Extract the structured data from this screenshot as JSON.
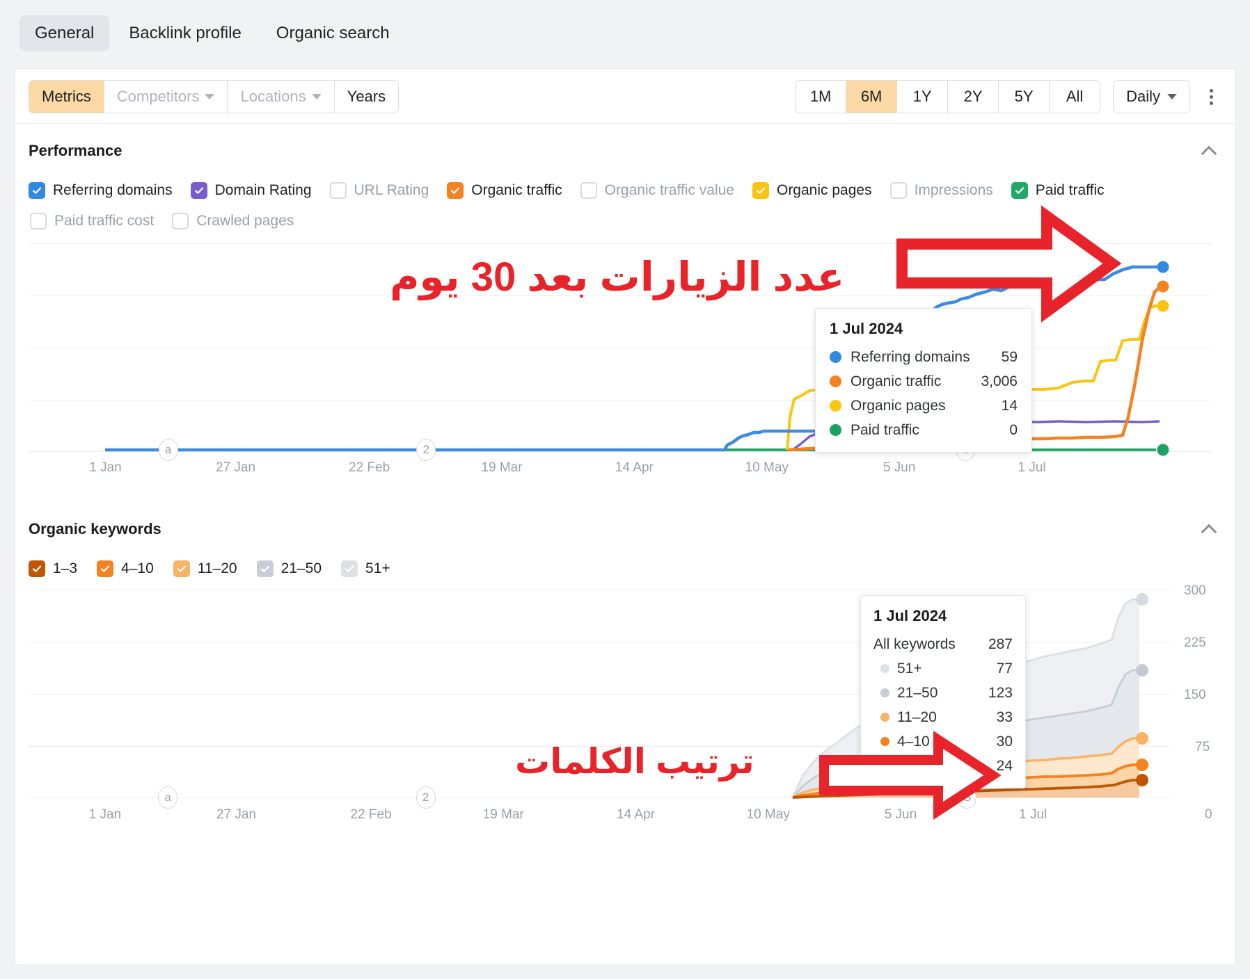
{
  "tabs": [
    {
      "label": "General",
      "active": true
    },
    {
      "label": "Backlink profile",
      "active": false
    },
    {
      "label": "Organic search",
      "active": false
    }
  ],
  "toolbar": {
    "metrics_label": "Metrics",
    "competitors_label": "Competitors",
    "locations_label": "Locations",
    "years_label": "Years",
    "ranges": [
      "1M",
      "6M",
      "1Y",
      "2Y",
      "5Y",
      "All"
    ],
    "range_selected": "6M",
    "granularity_label": "Daily",
    "more_label": "More options"
  },
  "performance": {
    "title": "Performance",
    "metrics": [
      {
        "label": "Referring domains",
        "checked": true,
        "color": "#2f8ae0"
      },
      {
        "label": "Domain Rating",
        "checked": true,
        "color": "#7a5bd0"
      },
      {
        "label": "URL Rating",
        "checked": false,
        "color": "#d7dadd"
      },
      {
        "label": "Organic traffic",
        "checked": true,
        "color": "#f58220"
      },
      {
        "label": "Organic traffic value",
        "checked": false,
        "color": "#d7dadd"
      },
      {
        "label": "Organic pages",
        "checked": true,
        "color": "#fbc411"
      },
      {
        "label": "Impressions",
        "checked": false,
        "color": "#d7dadd"
      },
      {
        "label": "Paid traffic",
        "checked": true,
        "color": "#22a866"
      },
      {
        "label": "Paid traffic cost",
        "checked": false,
        "color": "#d7dadd"
      },
      {
        "label": "Crawled pages",
        "checked": false,
        "color": "#d7dadd"
      }
    ],
    "x_ticks": [
      "1 Jan",
      "27 Jan",
      "22 Feb",
      "19 Mar",
      "14 Apr",
      "10 May",
      "5 Jun",
      "1 Jul"
    ],
    "events": [
      {
        "label": "a",
        "x": 0.105
      },
      {
        "label": "2",
        "x": 0.345
      },
      {
        "label": "G",
        "x": 0.862
      }
    ],
    "tooltip": {
      "date": "1 Jul 2024",
      "rows": [
        {
          "name": "Referring domains",
          "value": "59",
          "color": "#2f8ae0"
        },
        {
          "name": "Organic traffic",
          "value": "3,006",
          "color": "#f58220"
        },
        {
          "name": "Organic pages",
          "value": "14",
          "color": "#fbc411"
        },
        {
          "name": "Paid traffic",
          "value": "0",
          "color": "#1aa260"
        }
      ]
    },
    "annotation": "عدد الزيارات بعد 30 يوم"
  },
  "organic_keywords": {
    "title": "Organic keywords",
    "buckets": [
      {
        "label": "1–3",
        "checked": true,
        "color": "#c05600"
      },
      {
        "label": "4–10",
        "checked": true,
        "color": "#f58220"
      },
      {
        "label": "11–20",
        "checked": true,
        "color": "#fbb264"
      },
      {
        "label": "21–50",
        "checked": true,
        "color": "#c9ced6"
      },
      {
        "label": "51+",
        "checked": true,
        "color": "#dde1e6"
      }
    ],
    "x_ticks": [
      "1 Jan",
      "27 Jan",
      "22 Feb",
      "19 Mar",
      "14 Apr",
      "10 May",
      "5 Jun",
      "1 Jul"
    ],
    "y_ticks": [
      "300",
      "225",
      "150",
      "75",
      "0"
    ],
    "events": [
      {
        "label": "a",
        "x": 0.105
      },
      {
        "label": "2",
        "x": 0.345
      },
      {
        "label": "G",
        "x": 0.862
      }
    ],
    "tooltip": {
      "date": "1 Jul 2024",
      "total_label": "All keywords",
      "total_value": "287",
      "rows": [
        {
          "name": "51+",
          "value": "77",
          "color": "#dde1e6"
        },
        {
          "name": "21–50",
          "value": "123",
          "color": "#c9ced6"
        },
        {
          "name": "11–20",
          "value": "33",
          "color": "#fbb264"
        },
        {
          "name": "4–10",
          "value": "30",
          "color": "#f58220"
        },
        {
          "name": "1–3",
          "value": "24",
          "color": "#c05600"
        }
      ]
    },
    "annotation": "ترتيب الكلمات"
  },
  "colors": {
    "accent": "#fcd9a4",
    "annotation_red": "#e8232a",
    "referring_domains": "#2f8ae0",
    "domain_rating": "#7a5bd0",
    "organic_traffic": "#f58220",
    "organic_pages": "#fbc411",
    "paid_traffic": "#22a866"
  },
  "chart_data": [
    {
      "type": "line",
      "title": "Performance",
      "xlabel": "",
      "ylabel": "",
      "grid": true,
      "legend": "top",
      "x": [
        "1 Jan",
        "27 Jan",
        "22 Feb",
        "19 Mar",
        "14 Apr",
        "10 May",
        "5 Jun",
        "1 Jul"
      ],
      "xlim": [
        "1 Jan 2024",
        "1 Jul 2024"
      ],
      "ylim": [
        0,
        70
      ],
      "series": [
        {
          "name": "Referring domains",
          "color": "#2f8ae0",
          "final_value": 59,
          "values": [
            0,
            0,
            0,
            0,
            0,
            0,
            0,
            0,
            0,
            0,
            0,
            0,
            0,
            0,
            0,
            0,
            0,
            0,
            0,
            0,
            0,
            0,
            0,
            0,
            0,
            0,
            0,
            0,
            0,
            0,
            0,
            0,
            0,
            2,
            4,
            5,
            5,
            5,
            5,
            5,
            5,
            5,
            5,
            5,
            5,
            5,
            5,
            5,
            5,
            5,
            6,
            12,
            22,
            28,
            32,
            34,
            37,
            40,
            43,
            44,
            46,
            47,
            48,
            49,
            50,
            51,
            52,
            52,
            53,
            54,
            55,
            55,
            56,
            57,
            58,
            58,
            59,
            59,
            59,
            59
          ]
        },
        {
          "name": "Domain Rating",
          "color": "#7a5bd0",
          "final_value": null,
          "values": [
            0,
            0,
            0,
            0,
            0,
            0,
            0,
            0,
            0,
            0,
            0,
            0,
            0,
            0,
            0,
            0,
            0,
            0,
            0,
            0,
            0,
            0,
            0,
            0,
            0,
            0,
            0,
            0,
            0,
            0,
            0,
            0,
            0,
            0,
            0,
            0,
            0,
            0,
            0,
            0,
            0,
            0,
            0,
            0,
            0,
            0,
            0,
            0,
            0,
            0,
            0,
            1,
            2,
            3,
            4,
            5,
            5,
            6,
            6,
            6,
            6,
            7,
            7,
            7,
            7,
            7,
            7,
            7,
            7,
            7,
            7,
            7,
            7,
            7,
            7,
            7,
            7,
            7,
            7,
            7
          ]
        },
        {
          "name": "Organic traffic",
          "color": "#f58220",
          "final_value": 3006,
          "values": [
            0,
            0,
            0,
            0,
            0,
            0,
            0,
            0,
            0,
            0,
            0,
            0,
            0,
            0,
            0,
            0,
            0,
            0,
            0,
            0,
            0,
            0,
            0,
            0,
            0,
            0,
            0,
            0,
            0,
            0,
            0,
            0,
            0,
            0,
            0,
            0,
            0,
            0,
            0,
            0,
            0,
            0,
            0,
            0,
            0,
            0,
            0,
            0,
            0,
            0,
            0,
            0,
            1,
            1,
            1,
            1,
            2,
            2,
            2,
            2,
            2,
            2,
            2,
            3,
            3,
            3,
            3,
            3,
            3,
            4,
            4,
            4,
            4,
            4,
            5,
            20,
            40,
            55,
            60,
            62
          ]
        },
        {
          "name": "Organic pages",
          "color": "#fbc411",
          "final_value": 14,
          "values": [
            0,
            0,
            0,
            0,
            0,
            0,
            0,
            0,
            0,
            0,
            0,
            0,
            0,
            0,
            0,
            0,
            0,
            0,
            0,
            0,
            0,
            0,
            0,
            0,
            0,
            0,
            0,
            0,
            0,
            0,
            0,
            0,
            0,
            0,
            0,
            0,
            0,
            0,
            0,
            0,
            0,
            0,
            0,
            0,
            0,
            0,
            0,
            0,
            0,
            0,
            0,
            1,
            8,
            10,
            11,
            11,
            11,
            11,
            11,
            11,
            11,
            11,
            11,
            11,
            11,
            11,
            11,
            11,
            11,
            11,
            11,
            11,
            11,
            11,
            11,
            25,
            33,
            40,
            49,
            52
          ]
        },
        {
          "name": "Paid traffic",
          "color": "#22a866",
          "final_value": 0,
          "values": [
            0,
            0,
            0,
            0,
            0,
            0,
            0,
            0,
            0,
            0,
            0,
            0,
            0,
            0,
            0,
            0,
            0,
            0,
            0,
            0,
            0,
            0,
            0,
            0,
            0,
            0,
            0,
            0,
            0,
            0,
            0,
            0,
            0,
            0,
            0,
            0,
            0,
            0,
            0,
            0,
            0,
            0,
            0,
            0,
            0,
            0,
            0,
            0,
            0,
            0,
            0,
            0,
            0,
            0,
            0,
            0,
            0,
            0,
            0,
            0,
            0,
            0,
            0,
            0,
            0,
            0,
            0,
            0,
            0,
            0,
            0,
            0,
            0,
            0,
            0,
            0,
            0,
            0,
            0,
            0
          ]
        }
      ],
      "tooltip_point": {
        "date": "1 Jul 2024",
        "Referring domains": 59,
        "Organic traffic": 3006,
        "Organic pages": 14,
        "Paid traffic": 0
      }
    },
    {
      "type": "area",
      "stacked": true,
      "title": "Organic keywords",
      "xlabel": "",
      "ylabel": "",
      "grid": true,
      "legend": "top",
      "x": [
        "1 Jan",
        "27 Jan",
        "22 Feb",
        "19 Mar",
        "14 Apr",
        "10 May",
        "5 Jun",
        "1 Jul"
      ],
      "ylim": [
        0,
        300
      ],
      "yticks": [
        0,
        75,
        150,
        225,
        300
      ],
      "series": [
        {
          "name": "1–3",
          "color": "#c05600",
          "final_value": 24,
          "values": [
            0,
            0,
            0,
            0,
            0,
            0,
            0,
            0,
            0,
            0,
            0,
            0,
            0,
            0,
            0,
            0,
            0,
            0,
            0,
            0,
            0,
            0,
            0,
            0,
            0,
            0,
            0,
            0,
            0,
            0,
            0,
            0,
            0,
            0,
            0,
            0,
            0,
            0,
            0,
            0,
            0,
            0,
            0,
            0,
            0,
            0,
            0,
            0,
            0,
            0,
            0,
            0,
            1,
            2,
            3,
            4,
            5,
            6,
            7,
            8,
            9,
            10,
            11,
            12,
            13,
            14,
            15,
            16,
            17,
            18,
            19,
            20,
            21,
            21,
            22,
            22,
            23,
            23,
            24,
            24
          ]
        },
        {
          "name": "4–10",
          "color": "#f58220",
          "final_value": 30,
          "values": [
            0,
            0,
            0,
            0,
            0,
            0,
            0,
            0,
            0,
            0,
            0,
            0,
            0,
            0,
            0,
            0,
            0,
            0,
            0,
            0,
            0,
            0,
            0,
            0,
            0,
            0,
            0,
            0,
            0,
            0,
            0,
            0,
            0,
            0,
            0,
            0,
            0,
            0,
            0,
            0,
            0,
            0,
            0,
            0,
            0,
            0,
            0,
            0,
            0,
            0,
            0,
            0,
            2,
            5,
            8,
            11,
            13,
            15,
            17,
            18,
            19,
            20,
            21,
            22,
            23,
            24,
            25,
            25,
            26,
            26,
            27,
            27,
            28,
            28,
            29,
            29,
            30,
            30,
            30,
            30
          ]
        },
        {
          "name": "11–20",
          "color": "#fbb264",
          "final_value": 33,
          "values": [
            0,
            0,
            0,
            0,
            0,
            0,
            0,
            0,
            0,
            0,
            0,
            0,
            0,
            0,
            0,
            0,
            0,
            0,
            0,
            0,
            0,
            0,
            0,
            0,
            0,
            0,
            0,
            0,
            0,
            0,
            0,
            0,
            0,
            0,
            0,
            0,
            0,
            0,
            0,
            0,
            0,
            0,
            0,
            0,
            0,
            0,
            0,
            0,
            0,
            0,
            0,
            0,
            3,
            7,
            11,
            14,
            17,
            19,
            21,
            22,
            24,
            25,
            26,
            27,
            28,
            29,
            29,
            30,
            30,
            31,
            31,
            32,
            32,
            32,
            33,
            33,
            33,
            33,
            33,
            33
          ]
        },
        {
          "name": "21–50",
          "color": "#c9ced6",
          "final_value": 123,
          "values": [
            0,
            0,
            0,
            0,
            0,
            0,
            0,
            0,
            0,
            0,
            0,
            0,
            0,
            0,
            0,
            0,
            0,
            0,
            0,
            0,
            0,
            0,
            0,
            0,
            0,
            0,
            0,
            0,
            0,
            0,
            0,
            0,
            0,
            0,
            0,
            0,
            0,
            0,
            0,
            0,
            0,
            0,
            0,
            0,
            0,
            0,
            0,
            0,
            0,
            0,
            0,
            0,
            10,
            25,
            40,
            52,
            62,
            70,
            78,
            84,
            90,
            95,
            99,
            103,
            106,
            109,
            112,
            114,
            116,
            117,
            119,
            120,
            121,
            122,
            122,
            123,
            123,
            123,
            123,
            123
          ]
        },
        {
          "name": "51+",
          "color": "#dde1e6",
          "final_value": 77,
          "values": [
            0,
            0,
            0,
            0,
            0,
            0,
            0,
            0,
            0,
            0,
            0,
            0,
            0,
            0,
            0,
            0,
            0,
            0,
            0,
            0,
            0,
            0,
            0,
            0,
            0,
            0,
            0,
            0,
            0,
            0,
            0,
            0,
            0,
            0,
            0,
            0,
            0,
            0,
            0,
            0,
            0,
            0,
            0,
            0,
            0,
            0,
            0,
            0,
            0,
            0,
            0,
            0,
            6,
            14,
            22,
            30,
            36,
            41,
            46,
            50,
            54,
            57,
            60,
            63,
            65,
            67,
            69,
            70,
            72,
            73,
            74,
            75,
            76,
            76,
            77,
            77,
            77,
            77,
            77,
            77
          ]
        }
      ],
      "tooltip_point": {
        "date": "1 Jul 2024",
        "All keywords": 287,
        "51+": 77,
        "21–50": 123,
        "11–20": 33,
        "4–10": 30,
        "1–3": 24
      }
    }
  ]
}
